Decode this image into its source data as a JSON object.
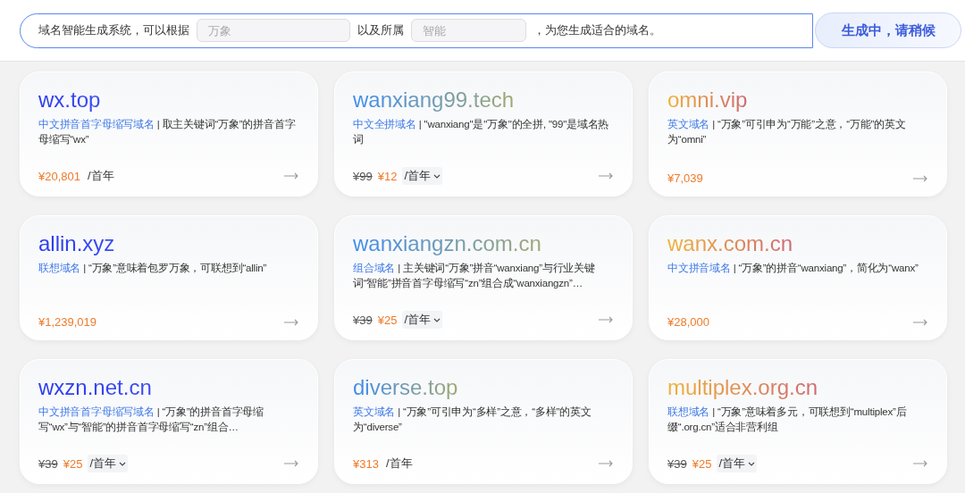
{
  "prompt": {
    "text_before": "域名智能生成系统，可以根据",
    "keyword_field": {
      "placeholder": "万象"
    },
    "text_middle": "以及所属",
    "industry_field": {
      "placeholder": "智能"
    },
    "text_after": "，为您生成适合的域名。"
  },
  "generate_button": {
    "label": "生成中，请稍候",
    "disabled": true
  },
  "cards": [
    {
      "domain": "wx.top",
      "kind": "indigo",
      "category": "中文拼音首字母缩写域名",
      "description": "| 取主关键词“万象”的拼音首字母缩写“wx”",
      "price": "¥20,801",
      "period": "/首年",
      "period_dropdown": false
    },
    {
      "domain": "wanxiang99.tech",
      "kind": "ocean",
      "category": "中文全拼域名",
      "description": "| \"wanxiang\"是\"万象\"的全拼, \"99\"是域名热词",
      "original_price": "¥99",
      "price": "¥12",
      "period": "/首年",
      "period_dropdown": true
    },
    {
      "domain": "omni.vip",
      "kind": "sunset",
      "category": "英文域名",
      "description": "| “万象”可引申为“万能”之意，“万能”的英文为“omni”",
      "price": "¥7,039"
    },
    {
      "domain": "allin.xyz",
      "kind": "indigo",
      "category": "联想域名",
      "description": "| “万象”意味着包罗万象，可联想到“allin”",
      "price": "¥1,239,019"
    },
    {
      "domain": "wanxiangzn.com.cn",
      "kind": "ocean",
      "category": "组合域名",
      "description": "| 主关键词“万象”拼音“wanxiang”与行业关键词“智能”拼音首字母缩写“zn”组合成“wanxiangzn”…",
      "original_price": "¥39",
      "price": "¥25",
      "period": "/首年",
      "period_dropdown": true
    },
    {
      "domain": "wanx.com.cn",
      "kind": "sunset",
      "category": "中文拼音域名",
      "description": "| “万象”的拼音“wanxiang”，简化为“wanx”",
      "price": "¥28,000"
    },
    {
      "domain": "wxzn.net.cn",
      "kind": "indigo",
      "category": "中文拼音首字母缩写域名",
      "description": "| “万象”的拼音首字母缩写“wx”与“智能”的拼音首字母缩写“zn”组合…",
      "original_price": "¥39",
      "price": "¥25",
      "period": "/首年",
      "period_dropdown": true
    },
    {
      "domain": "diverse.top",
      "kind": "ocean",
      "category": "英文域名",
      "description": "| “万象”可引申为“多样”之意，“多样”的英文为“diverse”",
      "price": "¥313",
      "period": "/首年",
      "period_dropdown": false
    },
    {
      "domain": "multiplex.org.cn",
      "kind": "sunset",
      "category": "联想域名",
      "description": "| “万象”意味着多元，可联想到“multiplex”后缀“.org.cn”适合非营利组",
      "original_price": "¥39",
      "price": "¥25",
      "period": "/首年",
      "period_dropdown": true
    }
  ]
}
